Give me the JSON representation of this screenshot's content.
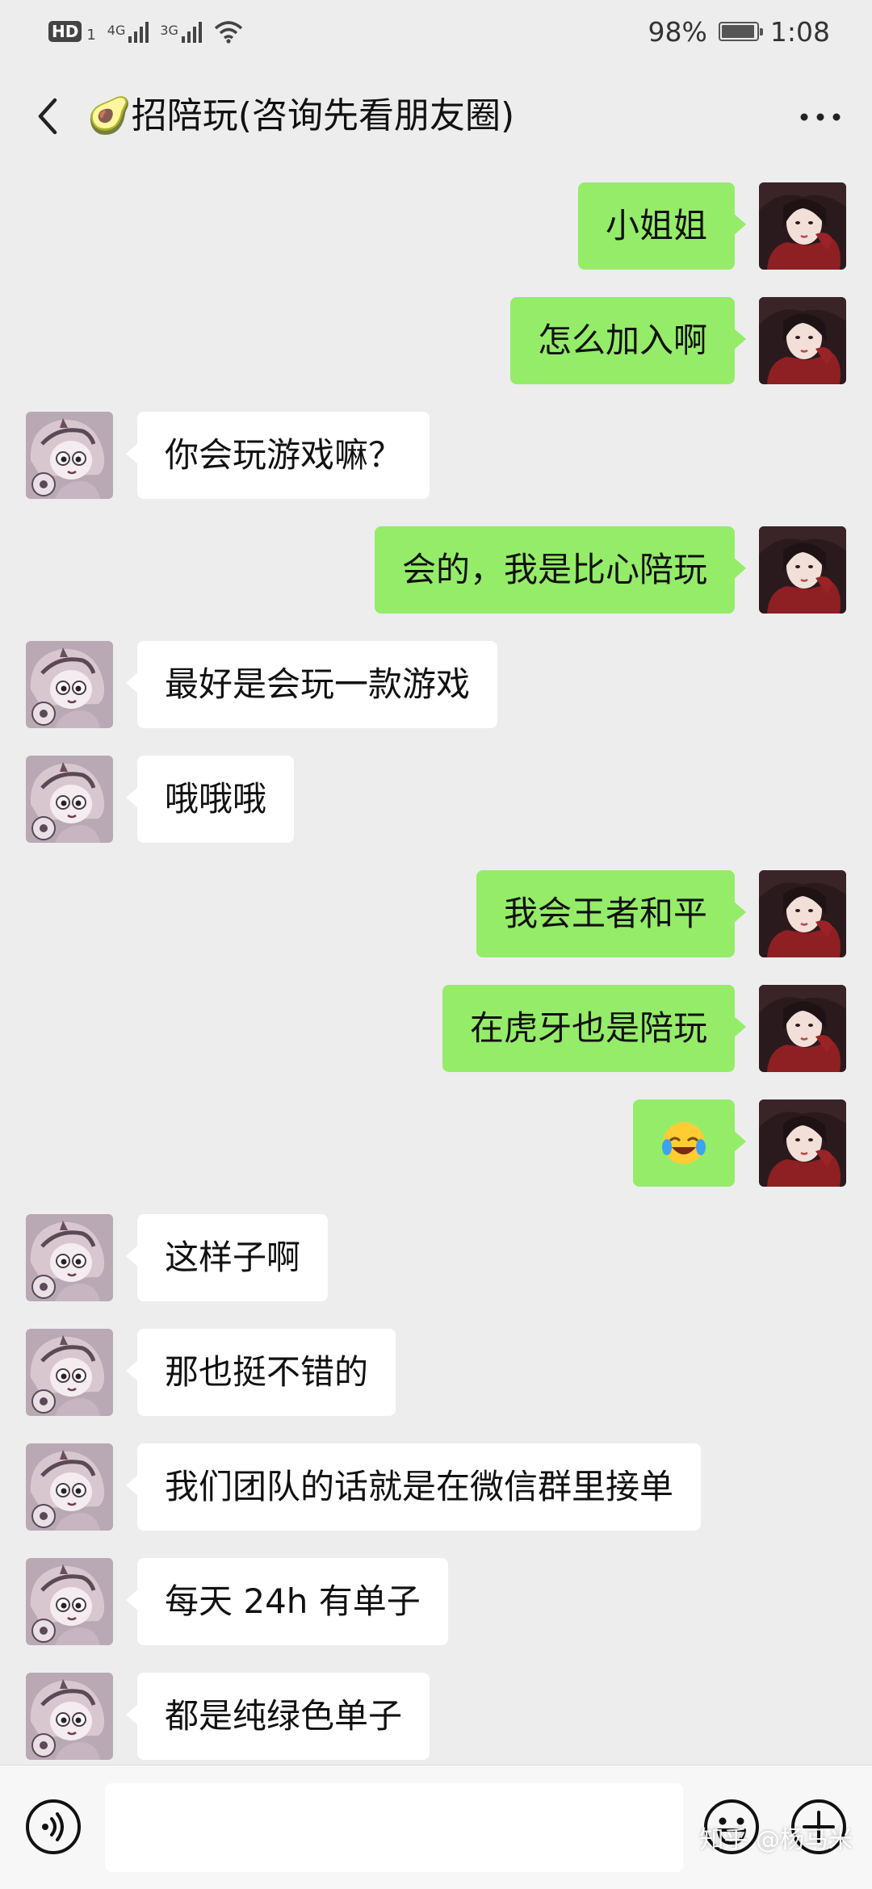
{
  "status_bar": {
    "hd": "HD",
    "sim": "1",
    "net1": "4G",
    "net2": "3G",
    "battery": "98%",
    "time": "1:08"
  },
  "header": {
    "title": "🥑招陪玩(咨询先看朋友圈)",
    "back_icon": "chevron-left-icon",
    "more_icon": "more-dots-icon"
  },
  "messages": [
    {
      "from": "self",
      "text": "小姐姐"
    },
    {
      "from": "self",
      "text": "怎么加入啊"
    },
    {
      "from": "other",
      "text": "你会玩游戏嘛？"
    },
    {
      "from": "self",
      "text": "会的，我是比心陪玩"
    },
    {
      "from": "other",
      "text": "最好是会玩一款游戏"
    },
    {
      "from": "other",
      "text": "哦哦哦"
    },
    {
      "from": "self",
      "text": "我会王者和平"
    },
    {
      "from": "self",
      "text": "在虎牙也是陪玩"
    },
    {
      "from": "self",
      "text": "😂"
    },
    {
      "from": "other",
      "text": "这样子啊"
    },
    {
      "from": "other",
      "text": "那也挺不错的"
    },
    {
      "from": "other",
      "text": "我们团队的话就是在微信群里接单"
    },
    {
      "from": "other",
      "text": "每天 24h 有单子"
    },
    {
      "from": "other",
      "text": "都是纯绿色单子"
    }
  ],
  "input_bar": {
    "voice_icon": "voice-icon",
    "emoji_icon": "emoji-icon",
    "plus_icon": "plus-icon",
    "input_value": ""
  },
  "watermark": "知乎 @杨马米",
  "colors": {
    "background": "#ededed",
    "outgoing_bubble": "#95ec69",
    "incoming_bubble": "#ffffff"
  }
}
